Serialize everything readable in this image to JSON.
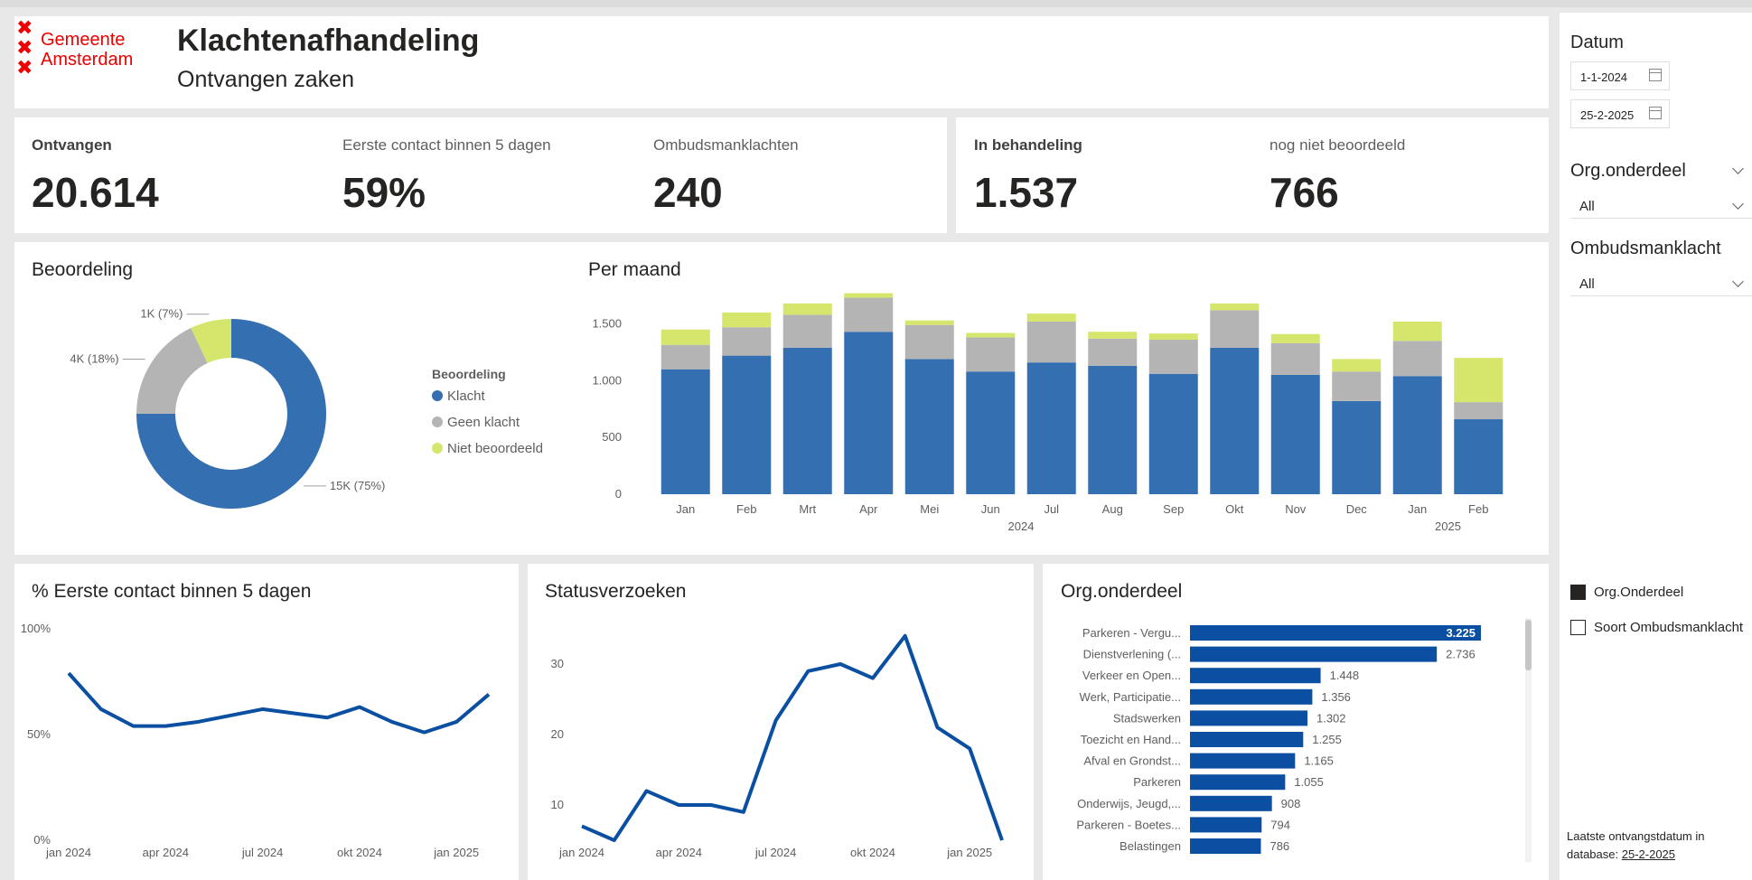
{
  "header": {
    "logo_line1": "Gemeente",
    "logo_line2": "Amsterdam",
    "title": "Klachtenafhandeling",
    "subtitle": "Ontvangen zaken"
  },
  "kpis": [
    {
      "label": "Ontvangen",
      "value": "20.614"
    },
    {
      "label": "Eerste contact binnen 5 dagen",
      "value": "59%"
    },
    {
      "label": "Ombudsmanklachten",
      "value": "240"
    },
    {
      "label": "In behandeling",
      "value": "1.537"
    },
    {
      "label": "nog niet beoordeeld",
      "value": "766"
    }
  ],
  "colors": {
    "klacht": "#346fb1",
    "geen_klacht": "#b4b4b4",
    "niet_beoordeeld": "#d6e56c",
    "line": "#0a4fa1",
    "bar": "#0a4fa1",
    "logo": "#ec0000"
  },
  "beoordeling": {
    "title": "Beoordeling",
    "legend_title": "Beoordeling",
    "slices": [
      {
        "name": "Klacht",
        "value": 75,
        "label": "15K (75%)"
      },
      {
        "name": "Geen klacht",
        "value": 18,
        "label": "4K (18%)"
      },
      {
        "name": "Niet beoordeeld",
        "value": 7,
        "label": "1K (7%)"
      }
    ]
  },
  "per_maand": {
    "title": "Per maand",
    "year_labels": [
      "2024",
      "2025"
    ],
    "yticks": [
      "0",
      "500",
      "1.000",
      "1.500"
    ]
  },
  "eerste_contact": {
    "title": "% Eerste contact binnen 5 dagen",
    "yticks": [
      "0%",
      "50%",
      "100%"
    ],
    "xticks": [
      "jan 2024",
      "apr 2024",
      "jul 2024",
      "okt 2024",
      "jan 2025"
    ]
  },
  "statusverzoeken": {
    "title": "Statusverzoeken",
    "yticks": [
      "10",
      "20",
      "30"
    ],
    "xticks": [
      "jan 2024",
      "apr 2024",
      "jul 2024",
      "okt 2024",
      "jan 2025"
    ]
  },
  "org": {
    "title": "Org.onderdeel",
    "items": [
      {
        "name": "Parkeren - Vergu...",
        "label": "3.225"
      },
      {
        "name": "Dienstverlening (...",
        "label": "2.736"
      },
      {
        "name": "Verkeer en Open...",
        "label": "1.448"
      },
      {
        "name": "Werk, Participatie...",
        "label": "1.356"
      },
      {
        "name": "Stadswerken",
        "label": "1.302"
      },
      {
        "name": "Toezicht en Hand...",
        "label": "1.255"
      },
      {
        "name": "Afval en Grondst...",
        "label": "1.165"
      },
      {
        "name": "Parkeren",
        "label": "1.055"
      },
      {
        "name": "Onderwijs, Jeugd,...",
        "label": "908"
      },
      {
        "name": "Parkeren - Boetes...",
        "label": "794"
      },
      {
        "name": "Belastingen",
        "label": "786"
      }
    ]
  },
  "sidebar": {
    "datum_title": "Datum",
    "date_from": "1-1-2024",
    "date_to": "25-2-2025",
    "org_title": "Org.onderdeel",
    "org_value": "All",
    "ombudsman_title": "Ombudsmanklacht",
    "ombudsman_value": "All",
    "legend1": "Org.Onderdeel",
    "legend2": "Soort Ombudsmanklacht",
    "footnote_text": "Laatste ontvangstdatum in database:",
    "footnote_date": "25-2-2025"
  },
  "chart_data": [
    {
      "type": "pie",
      "title": "Beoordeling",
      "categories": [
        "Klacht",
        "Geen klacht",
        "Niet beoordeeld"
      ],
      "values": [
        75,
        18,
        7
      ],
      "labels": [
        "15K (75%)",
        "4K (18%)",
        "1K (7%)"
      ]
    },
    {
      "type": "bar",
      "title": "Per maand",
      "stacked": true,
      "categories": [
        "Jan",
        "Feb",
        "Mrt",
        "Apr",
        "Mei",
        "Jun",
        "Jul",
        "Aug",
        "Sep",
        "Okt",
        "Nov",
        "Dec",
        "Jan",
        "Feb"
      ],
      "series": [
        {
          "name": "Klacht",
          "values": [
            1100,
            1220,
            1290,
            1430,
            1190,
            1080,
            1160,
            1130,
            1060,
            1290,
            1050,
            820,
            1040,
            660
          ]
        },
        {
          "name": "Geen klacht",
          "values": [
            215,
            250,
            290,
            300,
            300,
            300,
            360,
            240,
            300,
            330,
            280,
            260,
            310,
            150
          ]
        },
        {
          "name": "Niet beoordeeld",
          "values": [
            135,
            130,
            100,
            40,
            40,
            40,
            70,
            60,
            55,
            60,
            80,
            110,
            170,
            390
          ]
        }
      ],
      "ylim": [
        0,
        1750
      ]
    },
    {
      "type": "line",
      "title": "% Eerste contact binnen 5 dagen",
      "x": [
        "jan 2024",
        "feb 2024",
        "mrt 2024",
        "apr 2024",
        "mei 2024",
        "jun 2024",
        "jul 2024",
        "aug 2024",
        "sep 2024",
        "okt 2024",
        "nov 2024",
        "dec 2024",
        "jan 2025",
        "feb 2025"
      ],
      "values": [
        79,
        62,
        54,
        54,
        56,
        59,
        62,
        60,
        58,
        63,
        56,
        51,
        56,
        69
      ],
      "ylim": [
        0,
        100
      ]
    },
    {
      "type": "line",
      "title": "Statusverzoeken",
      "x": [
        "jan 2024",
        "feb 2024",
        "mrt 2024",
        "apr 2024",
        "mei 2024",
        "jun 2024",
        "jul 2024",
        "aug 2024",
        "sep 2024",
        "okt 2024",
        "nov 2024",
        "dec 2024",
        "jan 2025",
        "feb 2025"
      ],
      "values": [
        7,
        5,
        12,
        10,
        10,
        9,
        22,
        29,
        30,
        28,
        34,
        21,
        18,
        5
      ],
      "ylim": [
        5,
        35
      ]
    },
    {
      "type": "bar",
      "title": "Org.onderdeel",
      "orientation": "horizontal",
      "categories": [
        "Parkeren - Vergu...",
        "Dienstverlening (...",
        "Verkeer en Open...",
        "Werk, Participatie...",
        "Stadswerken",
        "Toezicht en Hand...",
        "Afval en Grondst...",
        "Parkeren",
        "Onderwijs, Jeugd,...",
        "Parkeren - Boetes...",
        "Belastingen"
      ],
      "values": [
        3225,
        2736,
        1448,
        1356,
        1302,
        1255,
        1165,
        1055,
        908,
        794,
        786
      ]
    }
  ]
}
